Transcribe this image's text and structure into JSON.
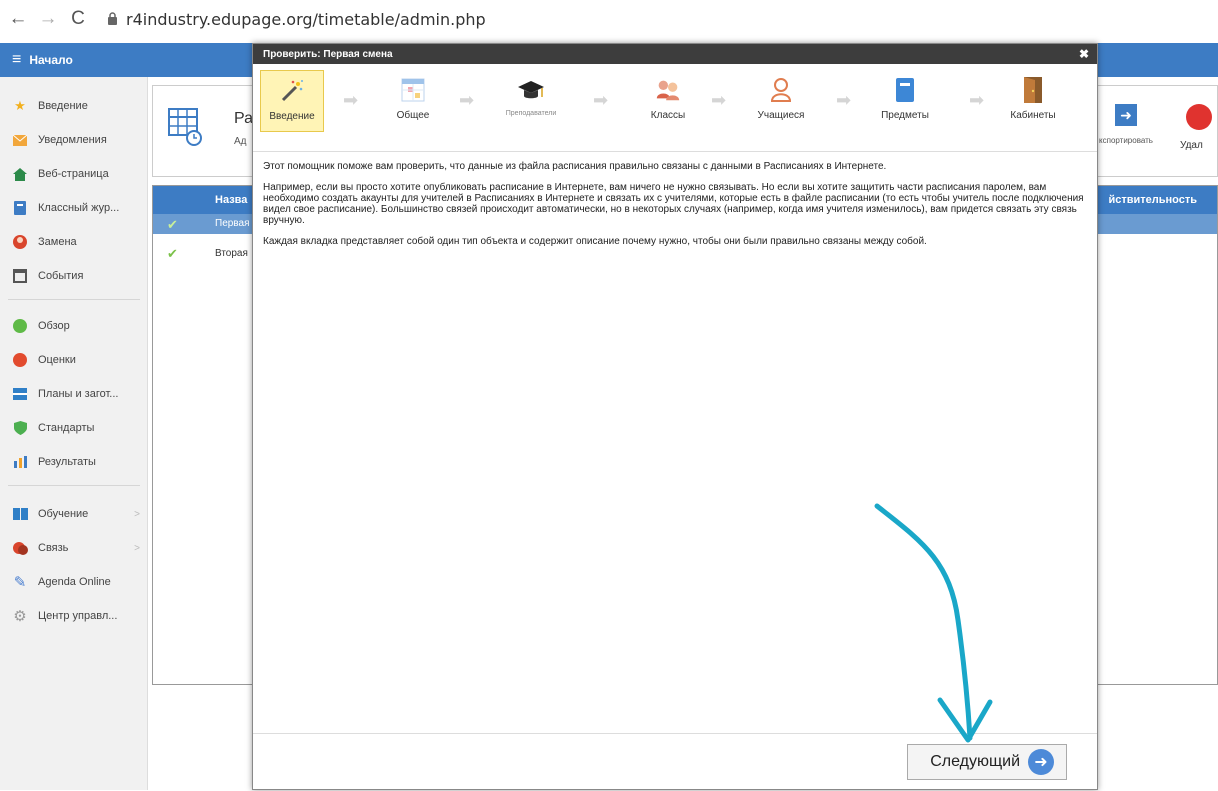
{
  "browser": {
    "url": "r4industry.edupage.org/timetable/admin.php"
  },
  "sidebar": {
    "home_label": "Начало",
    "items": [
      {
        "label": "Введение",
        "icon": "star-icon"
      },
      {
        "label": "Уведомления",
        "icon": "mail-icon"
      },
      {
        "label": "Веб-страница",
        "icon": "home-icon"
      },
      {
        "label": "Классный жур...",
        "icon": "journal-icon"
      },
      {
        "label": "Замена",
        "icon": "person-icon"
      },
      {
        "label": "События",
        "icon": "calendar-icon"
      },
      {
        "label": "Обзор",
        "icon": "overview-icon"
      },
      {
        "label": "Оценки",
        "icon": "grades-icon"
      },
      {
        "label": "Планы и загот...",
        "icon": "plans-icon"
      },
      {
        "label": "Стандарты",
        "icon": "shield-icon"
      },
      {
        "label": "Результаты",
        "icon": "bar-chart-icon"
      },
      {
        "label": "Обучение",
        "icon": "book-icon"
      },
      {
        "label": "Связь",
        "icon": "chat-icon"
      },
      {
        "label": "Agenda Online",
        "icon": "pen-icon"
      },
      {
        "label": "Центр управл...",
        "icon": "gear-icon"
      }
    ]
  },
  "background": {
    "title": "Ра",
    "subtitle": "Ад",
    "export_label": "кспортировать",
    "delete_label": "Удал",
    "table": {
      "col_name": "Назва",
      "col_valid": "йствительность",
      "rows": [
        "Первая",
        "Вторая"
      ]
    }
  },
  "modal": {
    "title": "Проверить: Первая смена",
    "steps": [
      {
        "label": "Введение",
        "active": true
      },
      {
        "label": "Общее",
        "active": false
      },
      {
        "label": "Преподаватели",
        "active": false
      },
      {
        "label": "Классы",
        "active": false
      },
      {
        "label": "Учащиеся",
        "active": false
      },
      {
        "label": "Предметы",
        "active": false
      },
      {
        "label": "Кабинеты",
        "active": false
      }
    ],
    "paragraphs": [
      "Этот помощник поможе вам проверить, что данные из файла расписания правильно связаны с данными в Расписаниях в Интернете.",
      "Например, если вы просто хотите опубликовать расписание в Интернете, вам ничего не нужно связывать. Но если вы хотите защитить части расписания паролем, вам необходимо создать акаунты для учителей в Расписаниях в Интернете и связать их с учителями, которые есть в файле расписании (то есть чтобы учитель после подключения видел свое расписание). Большинство связей происходит автоматически, но в некоторых случаях (например, когда имя учителя изменилось), вам придется связать эту связь вручную.",
      "Каждая вкладка представляет собой один тип объекта и содержит описание почему нужно, чтобы они были правильно связаны между собой."
    ],
    "next_label": "Следующий"
  },
  "colors": {
    "accent": "#3d7cc4",
    "annotation": "#1aa7c8",
    "active_step": "#fff4b6"
  }
}
